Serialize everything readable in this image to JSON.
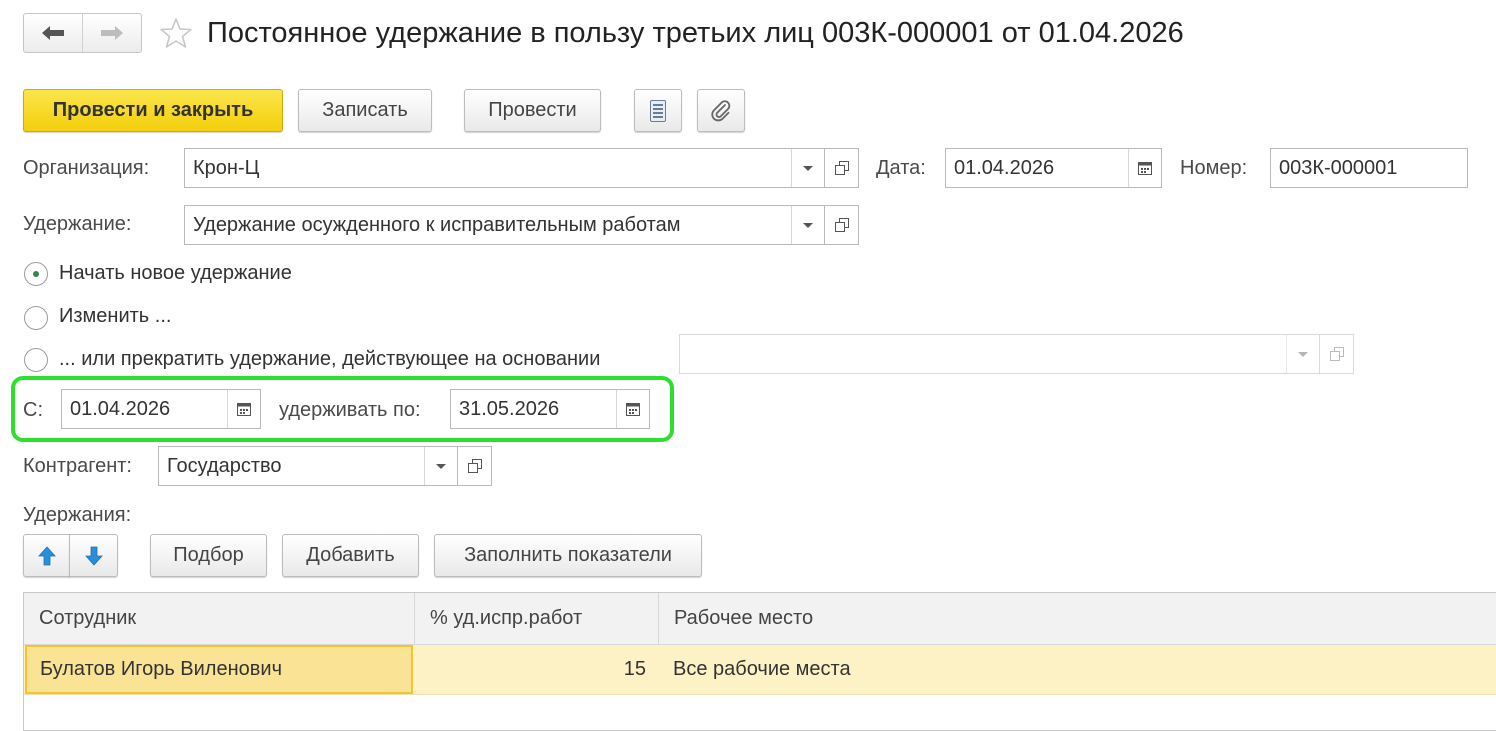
{
  "header": {
    "back_icon": "arrow-left-icon",
    "forward_icon": "arrow-right-icon",
    "favorite_icon": "star-icon",
    "title": "Постоянное удержание в пользу третьих лиц 003К-000001 от 01.04.2026"
  },
  "toolbar": {
    "post_close": "Провести и закрыть",
    "save": "Записать",
    "post": "Провести",
    "report_icon": "report-icon",
    "attach_icon": "paperclip-icon"
  },
  "form": {
    "org_label": "Организация:",
    "org_value": "Крон-Ц",
    "date_label": "Дата:",
    "date_value": "01.04.2026",
    "number_label": "Номер:",
    "number_value": "003К-000001",
    "deduction_label": "Удержание:",
    "deduction_value": "Удержание осужденного к исправительным работам",
    "radio_new": "Начать новое удержание",
    "radio_change": "Изменить ...",
    "radio_stop": "... или прекратить удержание, действующее на основании",
    "stop_basis_value": "",
    "from_label": "С:",
    "from_value": "01.04.2026",
    "until_label": "удерживать по:",
    "until_value": "31.05.2026",
    "counterparty_label": "Контрагент:",
    "counterparty_value": "Государство"
  },
  "deductions": {
    "section_label": "Удержания:",
    "up_icon": "arrow-up-icon",
    "down_icon": "arrow-down-icon",
    "pick": "Подбор",
    "add": "Добавить",
    "fill": "Заполнить показатели",
    "columns": [
      "Сотрудник",
      "% уд.испр.работ",
      "Рабочее место"
    ],
    "rows": [
      [
        "Булатов Игорь Виленович",
        "15",
        "Все рабочие места"
      ]
    ]
  },
  "colors": {
    "primary_button": "#f5d41a",
    "highlight_frame": "#2ee02e",
    "selected_row": "#fdf1c6",
    "arrow_blue": "#2b8fd8"
  }
}
